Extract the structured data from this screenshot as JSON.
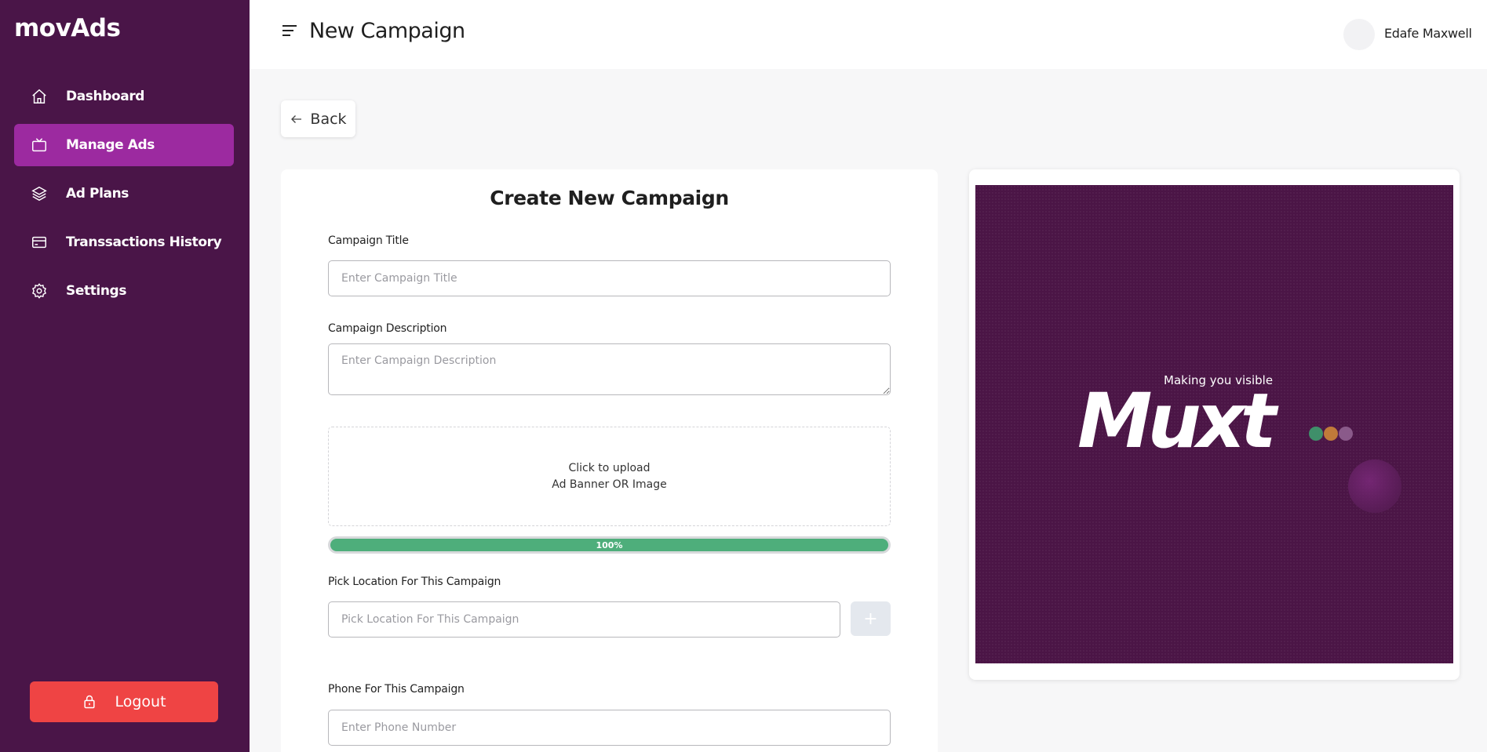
{
  "app": {
    "brand": "movAds"
  },
  "sidebar": {
    "items": [
      {
        "label": "Dashboard",
        "icon": "home-icon",
        "active": false
      },
      {
        "label": "Manage Ads",
        "icon": "tv-icon",
        "active": true
      },
      {
        "label": "Ad Plans",
        "icon": "layers-icon",
        "active": false
      },
      {
        "label": "Transsactions History",
        "icon": "credit-card-icon",
        "active": false
      },
      {
        "label": "Settings",
        "icon": "gear-icon",
        "active": false
      }
    ],
    "logout_label": "Logout"
  },
  "header": {
    "title": "New Campaign",
    "user_name": "Edafe Maxwell"
  },
  "back_label": "Back",
  "form": {
    "title": "Create New Campaign",
    "campaign_title": {
      "label": "Campaign Title",
      "placeholder": "Enter Campaign Title",
      "value": ""
    },
    "campaign_description": {
      "label": "Campaign Description",
      "placeholder": "Enter Campaign Description",
      "value": ""
    },
    "upload": {
      "line1": "Click to upload",
      "line2": "Ad Banner OR Image"
    },
    "progress": {
      "percent": 100,
      "label": "100%"
    },
    "location": {
      "label": "Pick Location For This Campaign",
      "placeholder": "Pick Location For This Campaign",
      "value": "",
      "add_label": "+"
    },
    "phone": {
      "label": "Phone For This Campaign",
      "placeholder": "Enter Phone Number",
      "value": ""
    }
  },
  "preview": {
    "tagline": "Making you visible",
    "wordmark": "Muxt",
    "dot_colors": [
      "#3f8f6a",
      "#c07a3a",
      "#8a5a8a"
    ],
    "background_color": "#4b1546"
  },
  "colors": {
    "sidebar_bg": "#4a1548",
    "active_item": "#9c2aa0",
    "logout_bg": "#ef4444",
    "progress": "#4eae7b"
  }
}
